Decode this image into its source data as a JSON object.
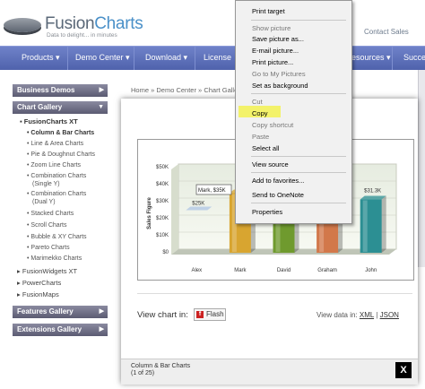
{
  "header": {
    "logo_text_1": "Fusion",
    "logo_text_2": "Charts",
    "tagline": "Data to delight... in minutes",
    "contact_link": "Contact Sales"
  },
  "nav": {
    "items": [
      "Products",
      "Demo Center",
      "Download",
      "License",
      "esources",
      "Succe"
    ]
  },
  "sidebar": {
    "business_demos": "Business Demos",
    "chart_gallery": "Chart Gallery",
    "fusioncharts_xt": "FusionCharts XT",
    "links": [
      "Column & Bar Charts",
      "Line & Area Charts",
      "Pie & Doughnut Charts",
      "Zoom Line Charts",
      "Combination Charts",
      "(Single Y)",
      "Combination Charts",
      "(Dual Y)",
      "Stacked Charts",
      "Scroll Charts",
      "Bubble & XY Charts",
      "Pareto Charts",
      "Marimekko Charts"
    ],
    "sub_links": [
      "FusionWidgets XT",
      "PowerCharts",
      "FusionMaps"
    ],
    "features_gallery": "Features Gallery",
    "extensions_gallery": "Extensions Gallery"
  },
  "breadcrumb": [
    "Home",
    "Demo Center",
    "Chart Galle"
  ],
  "modal": {
    "view_chart_label": "View chart in:",
    "flash_label": "Flash",
    "view_data_label": "View data in:",
    "xml_link": "XML",
    "separator": "|",
    "json_link": "JSON",
    "footer_title": "Column & Bar Charts",
    "footer_count": "(1 of 25)",
    "close_symbol": "X"
  },
  "chart_data": {
    "type": "bar",
    "categories": [
      "Alex",
      "Mark",
      "David",
      "Graham",
      "John"
    ],
    "values": [
      25,
      35,
      42,
      35,
      31.3
    ],
    "ylabel": "Sales Figure",
    "ylim": [
      0,
      50
    ],
    "yticks": [
      "$0",
      "$10K",
      "$20K",
      "$30K",
      "$40K",
      "$50K"
    ],
    "data_labels": [
      "$25K",
      "",
      "",
      "",
      "$31.3K"
    ],
    "tooltip": "Mark, $35K",
    "bar_colors": [
      "#b9cde6",
      "#d8a530",
      "#6f9a2e",
      "#d2784a",
      "#2c8f93"
    ],
    "legend": "none"
  },
  "context_menu": {
    "items": [
      {
        "label": "Print target",
        "disabled": false
      },
      {
        "label": "Show picture",
        "disabled": true
      },
      {
        "label": "Save picture as...",
        "disabled": false
      },
      {
        "label": "E-mail picture...",
        "disabled": false
      },
      {
        "label": "Print picture...",
        "disabled": false
      },
      {
        "label": "Go to My Pictures",
        "disabled": true
      },
      {
        "label": "Set as background",
        "disabled": false
      },
      {
        "label": "Cut",
        "disabled": true
      },
      {
        "label": "Copy",
        "disabled": false
      },
      {
        "label": "Copy shortcut",
        "disabled": true
      },
      {
        "label": "Paste",
        "disabled": true
      },
      {
        "label": "Select all",
        "disabled": false
      },
      {
        "label": "View source",
        "disabled": false
      },
      {
        "label": "Add to favorites...",
        "disabled": false
      },
      {
        "label": "Send to OneNote",
        "disabled": false
      },
      {
        "label": "Properties",
        "disabled": false
      }
    ],
    "highlight_color": "#f3f26a"
  }
}
